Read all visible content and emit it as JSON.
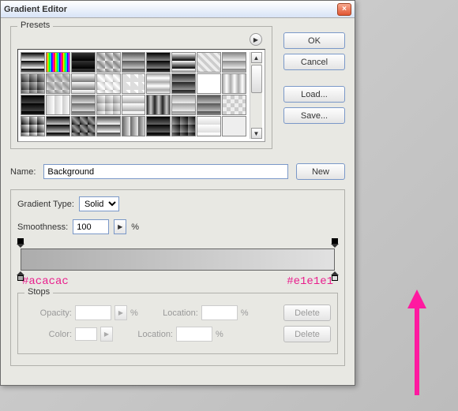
{
  "window": {
    "title": "Gradient Editor"
  },
  "buttons": {
    "ok": "OK",
    "cancel": "Cancel",
    "load": "Load...",
    "save": "Save...",
    "new": "New",
    "delete": "Delete"
  },
  "presets": {
    "legend": "Presets"
  },
  "name": {
    "label": "Name:",
    "value": "Background"
  },
  "gradient_type": {
    "label": "Gradient Type:",
    "value": "Solid"
  },
  "smoothness": {
    "label": "Smoothness:",
    "value": "100",
    "unit": "%"
  },
  "gradient": {
    "left_color": "#acacac",
    "right_color": "#e1e1e1"
  },
  "stops": {
    "legend": "Stops",
    "opacity_label": "Opacity:",
    "opacity_unit": "%",
    "color_label": "Color:",
    "location_label": "Location:",
    "location_unit": "%"
  },
  "swatches": [
    "linear-gradient(#000,#fff)",
    "linear-gradient(90deg,red,yellow,lime,cyan,blue,magenta,red)",
    "linear-gradient(#333,#000)",
    "linear-gradient(45deg,#fff,#888,#fff)",
    "linear-gradient(#555,#ccc)",
    "linear-gradient(#000,#888)",
    "linear-gradient(#fff,#000)",
    "linear-gradient(45deg,#eee 25%,#ccc 25%,#ccc 50%,#eee 50%,#eee 75%,#ccc 75%)",
    "linear-gradient(#888,#eee)",
    "linear-gradient(45deg,#222,#ccc)",
    "linear-gradient(45deg,#eee,#999,#eee)",
    "linear-gradient(#fff,#777)",
    "linear-gradient(45deg,#bbb,#fff,#bbb)",
    "linear-gradient(45deg,#ddd 0,#ddd 10px,#fff 10px,#fff 20px)",
    "linear-gradient(#aaa,#fff,#aaa)",
    "linear-gradient(#222,#999)",
    "linear-gradient(#fff,#fff)",
    "linear-gradient(90deg,#aaa,#fff,#aaa)",
    "linear-gradient(#000,#444)",
    "linear-gradient(90deg,#ccc,#fff)",
    "linear-gradient(#666,#ddd)",
    "linear-gradient(45deg,#888,#fff)",
    "linear-gradient(#fff,#aaa)",
    "linear-gradient(90deg,#222,#ccc,#222)",
    "linear-gradient(#999,#eee)",
    "linear-gradient(#555,#bbb)",
    "repeating-conic-gradient(#eee 0 25%,#ccc 0 50%)",
    "linear-gradient(45deg,#000,#fff)",
    "linear-gradient(#000,#ccc)",
    "linear-gradient(45deg,#000,#999,#000)",
    "linear-gradient(#444,#fff)",
    "linear-gradient(90deg,#666,#eee)",
    "linear-gradient(#000,#666)",
    "linear-gradient(45deg,#aaa,#000)",
    "linear-gradient(#fff,#ddd)",
    "linear-gradient(#eee,#eee)"
  ]
}
